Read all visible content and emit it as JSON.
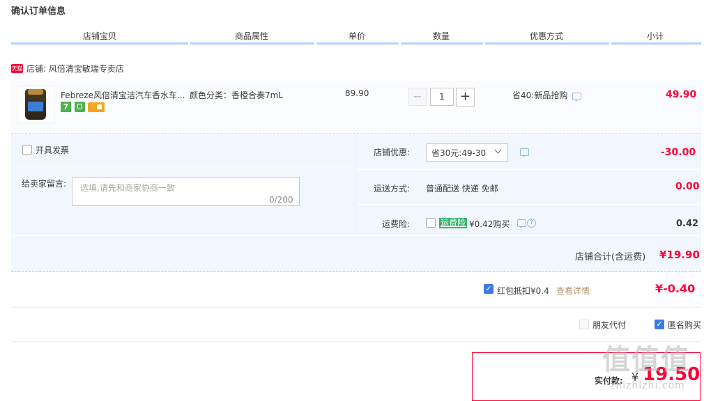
{
  "page": {
    "title": "确认订单信息"
  },
  "table_headers": [
    "店铺宝贝",
    "商品属性",
    "单价",
    "数量",
    "优惠方式",
    "小计"
  ],
  "shop": {
    "logo_text": "天猫",
    "label": "店铺: 风倍清宝敏瑞专卖店"
  },
  "item": {
    "title": "Febreze风倍清宝洁汽车香水车...",
    "attr": "颜色分类：香橙合奏7mL",
    "price": "89.90",
    "qty_minus": "−",
    "qty": "1",
    "qty_plus": "+",
    "promo": "省40:新品抢购",
    "subtotal": "49.90",
    "badge_7": "7"
  },
  "invoice": {
    "label": "开具发票",
    "checked": false
  },
  "message": {
    "label": "给卖家留言:",
    "placeholder": "选填,请先和商家协商一致",
    "counter": "0/200"
  },
  "shop_discount": {
    "label": "店铺优惠:",
    "selected": "省30元:49-30",
    "value": "-30.00"
  },
  "shipping": {
    "label": "运送方式:",
    "value_text": "普通配送 快递 免邮",
    "amount": "0.00"
  },
  "insurance": {
    "label": "运费险:",
    "badge": "运费险",
    "price_text": "¥0.42购买",
    "amount": "0.42",
    "help": "?"
  },
  "shop_total": {
    "label": "店铺合计(含运费)",
    "value": "¥19.90"
  },
  "red_packet": {
    "label": "红包抵扣¥0.4",
    "link": "查看详情",
    "value": "¥-0.40",
    "checked": true
  },
  "options": {
    "friend_pay": "朋友代付",
    "friend_pay_checked": false,
    "anonymous": "匿名购买",
    "anonymous_checked": true
  },
  "payment": {
    "label": "实付款:",
    "currency": "¥",
    "amount": "19.50"
  },
  "watermark": {
    "logo": "值值值",
    "site": "zhizhizhi.com"
  },
  "colors": {
    "accent_red": "#ff0036",
    "header_line": "#b2d1ff",
    "option_bg": "#f2f7ff",
    "checkbox_blue": "#3d7ae8"
  }
}
